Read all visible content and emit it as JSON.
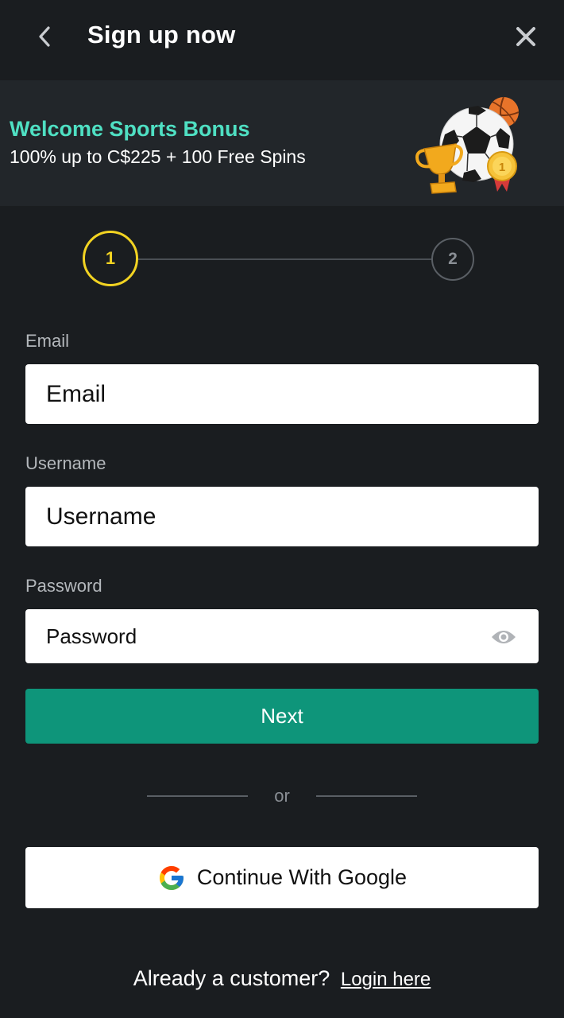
{
  "header": {
    "title": "Sign up now",
    "back_icon": "chevron-left-icon",
    "close_icon": "close-icon"
  },
  "banner": {
    "title": "Welcome Sports Bonus",
    "subtitle": "100% up to C$225 + 100 Free Spins",
    "title_color": "#4fe0c3"
  },
  "stepper": {
    "steps": [
      {
        "label": "1",
        "active": true
      },
      {
        "label": "2",
        "active": false
      }
    ],
    "active_color": "#f2d322"
  },
  "form": {
    "email": {
      "label": "Email",
      "placeholder": "Email",
      "value": ""
    },
    "username": {
      "label": "Username",
      "placeholder": "Username",
      "value": ""
    },
    "password": {
      "label": "Password",
      "placeholder": "Password",
      "value": "",
      "toggle_icon": "eye-icon"
    },
    "next_label": "Next",
    "next_color": "#0e957a"
  },
  "divider": {
    "text": "or"
  },
  "google": {
    "label": "Continue With Google",
    "icon": "google-icon"
  },
  "footer": {
    "prompt": "Already a customer?",
    "link": "Login here"
  }
}
